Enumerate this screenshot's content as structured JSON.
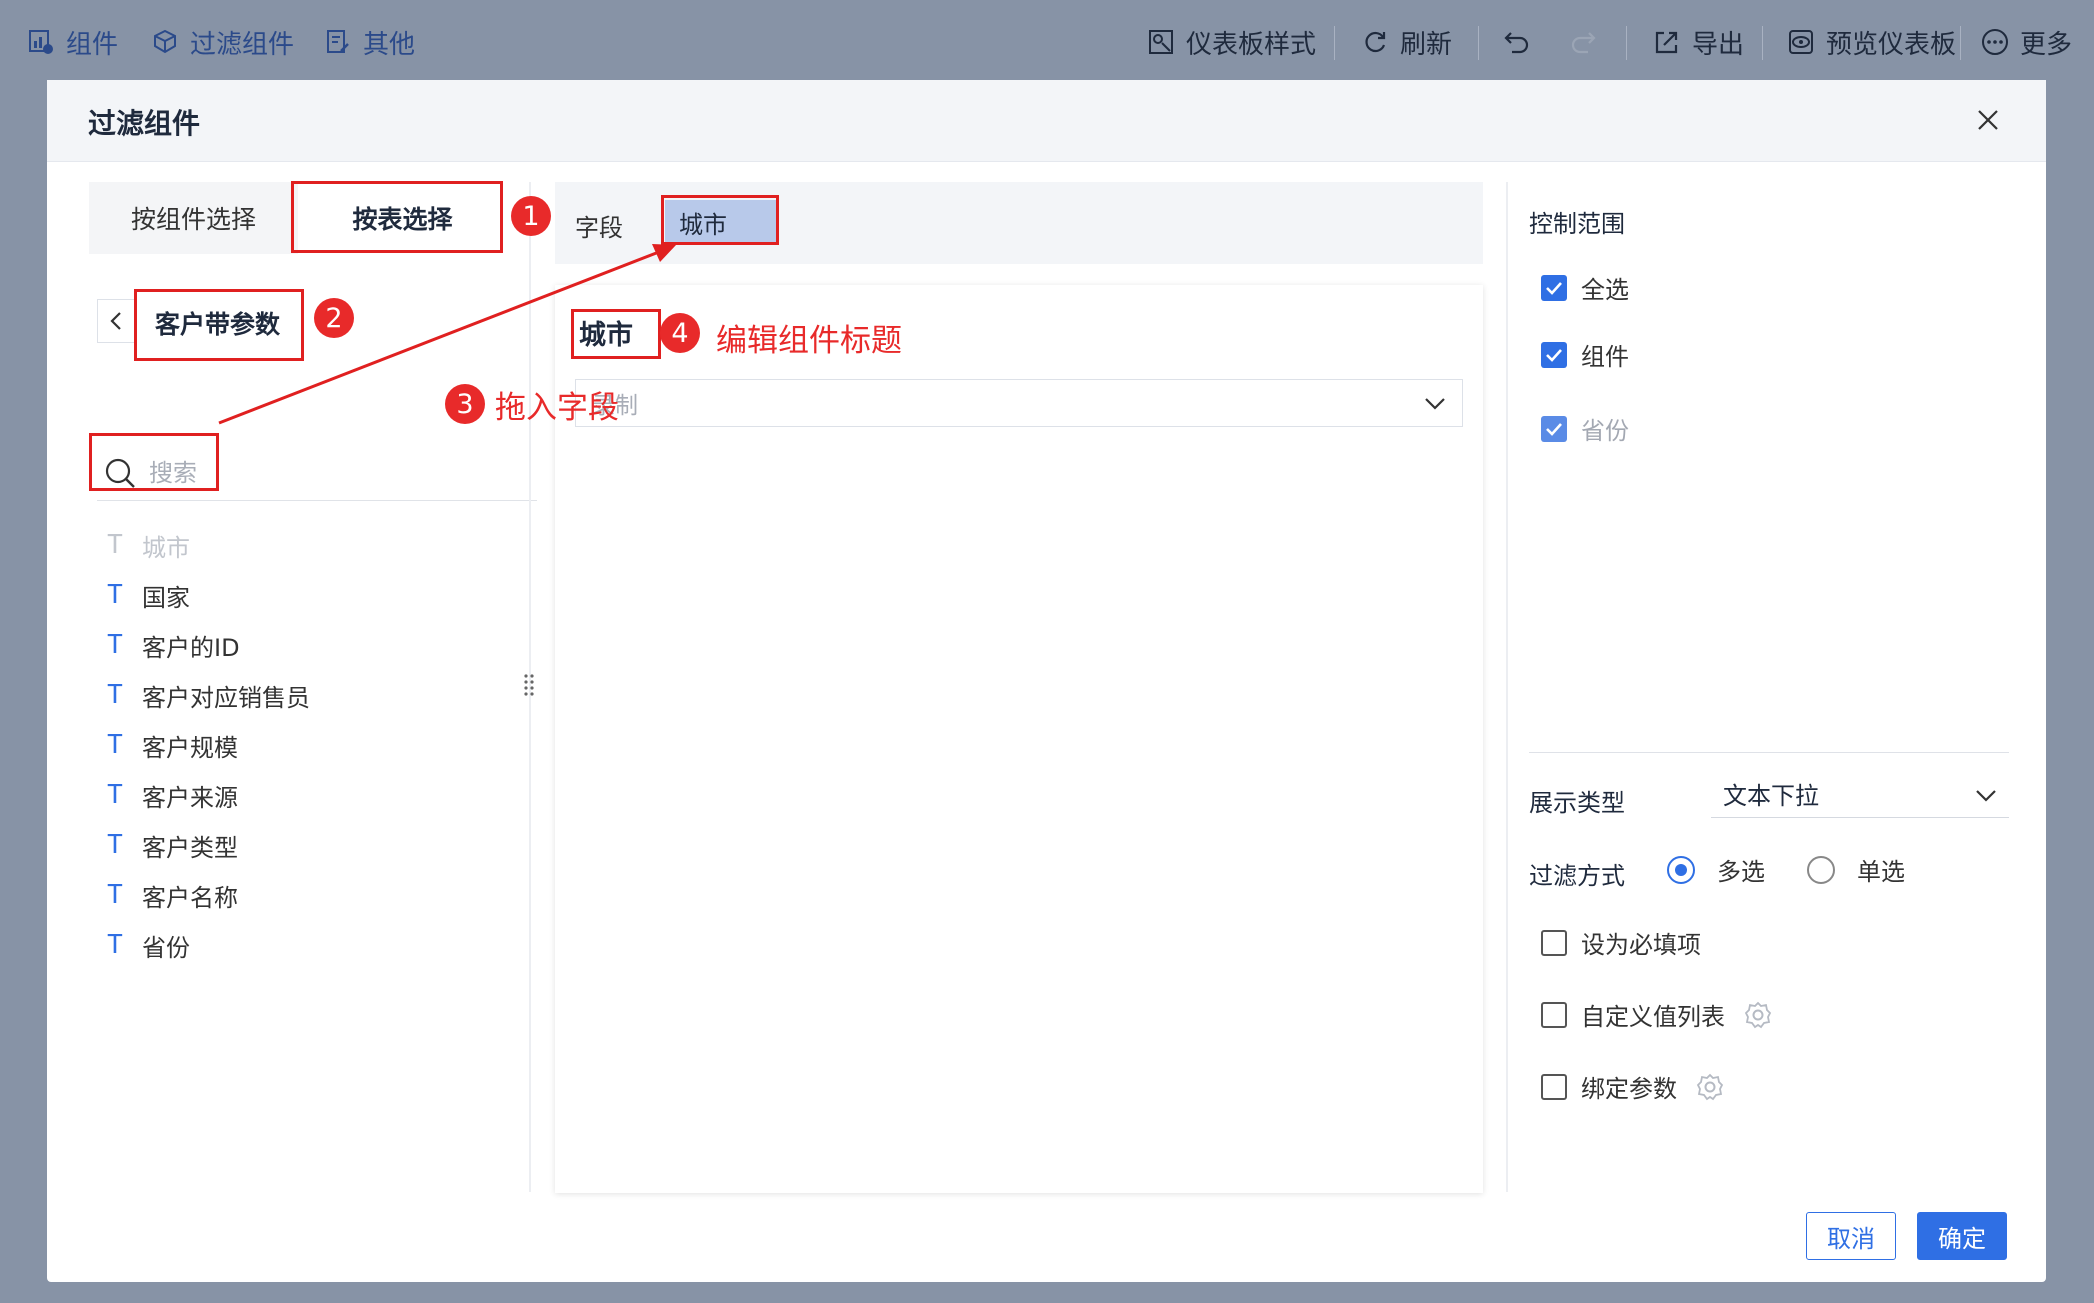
{
  "toolbar": {
    "component": "组件",
    "filter_component": "过滤组件",
    "other": "其他",
    "dashboard_style": "仪表板样式",
    "refresh": "刷新",
    "export": "导出",
    "preview_dashboard": "预览仪表板",
    "more": "更多"
  },
  "dialog": {
    "title": "过滤组件",
    "tabs": [
      "按组件选择",
      "按表选择"
    ],
    "table_name": "客户带参数",
    "search_placeholder": "搜索",
    "fields": [
      "城市",
      "国家",
      "客户的ID",
      "客户对应销售员",
      "客户规模",
      "客户来源",
      "客户类型",
      "客户名称",
      "省份"
    ],
    "field_bar_label": "字段",
    "selected_field": "城市",
    "preview_title": "城市",
    "select_placeholder": "录制",
    "control_scope": {
      "title": "控制范围",
      "select_all": "全选",
      "component": "组件",
      "province": "省份"
    },
    "display_type_label": "展示类型",
    "display_type_value": "文本下拉",
    "filter_mode_label": "过滤方式",
    "multi": "多选",
    "single": "单选",
    "required": "设为必填项",
    "custom_value_list": "自定义值列表",
    "bind_param": "绑定参数",
    "cancel": "取消",
    "ok": "确定"
  },
  "annotations": {
    "n1": "1",
    "n2": "2",
    "n3": "3",
    "n4": "4",
    "drag_text": "拖入字段",
    "edit_title_text": "编辑组件标题"
  },
  "colors": {
    "accent": "#2f6fe4",
    "annotation_red": "#e82a2a",
    "backdrop": "#8793a6"
  }
}
